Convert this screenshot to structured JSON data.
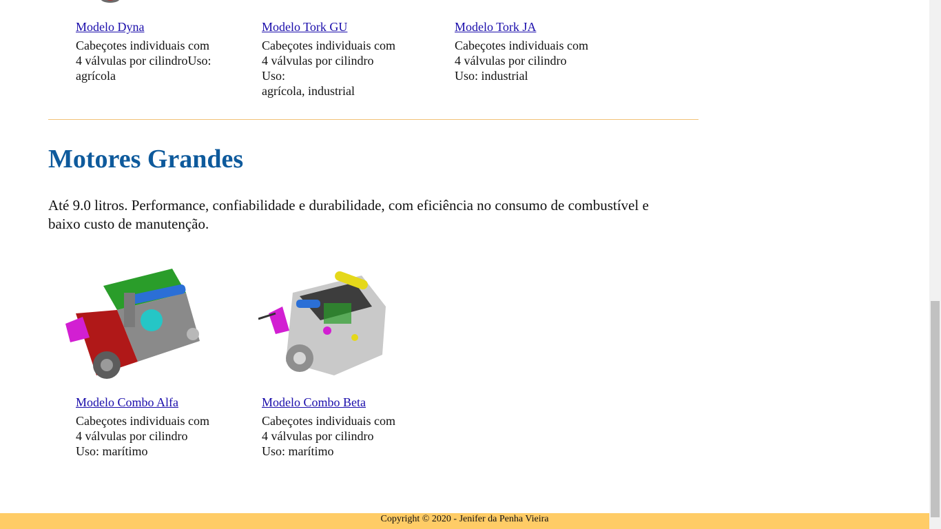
{
  "top_products": [
    {
      "name": "Modelo Dyna",
      "desc_lines": [
        "Cabeçotes individuais com",
        "4 válvulas por cilindroUso:",
        "agrícola"
      ]
    },
    {
      "name": "Modelo Tork GU",
      "desc_lines": [
        "Cabeçotes individuais com",
        "4 válvulas por cilindro",
        "Uso:",
        "agrícola, industrial"
      ]
    },
    {
      "name": "Modelo Tork JA",
      "desc_lines": [
        "Cabeçotes individuais com",
        "4 válvulas por cilindro",
        "Uso: industrial"
      ]
    }
  ],
  "section": {
    "title": "Motores Grandes",
    "intro": "Até 9.0 litros. Performance, confiabilidade e durabilidade, com eficiência no consumo de combustível e baixo custo de manutenção."
  },
  "large_products": [
    {
      "name": "Modelo Combo Alfa",
      "desc_lines": [
        "Cabeçotes individuais com",
        "4 válvulas por cilindro",
        "Uso: marítimo"
      ]
    },
    {
      "name": "Modelo Combo Beta",
      "desc_lines": [
        "Cabeçotes individuais com",
        "4 válvulas por cilindro",
        "Uso: marítimo"
      ]
    }
  ],
  "footer": {
    "text": "Copyright © 2020 - Jenifer da Penha Vieira"
  },
  "colors": {
    "heading": "#0e5a9c",
    "link": "#1a0dab",
    "divider": "#f2c277",
    "footer_bg": "#ffcc66"
  }
}
